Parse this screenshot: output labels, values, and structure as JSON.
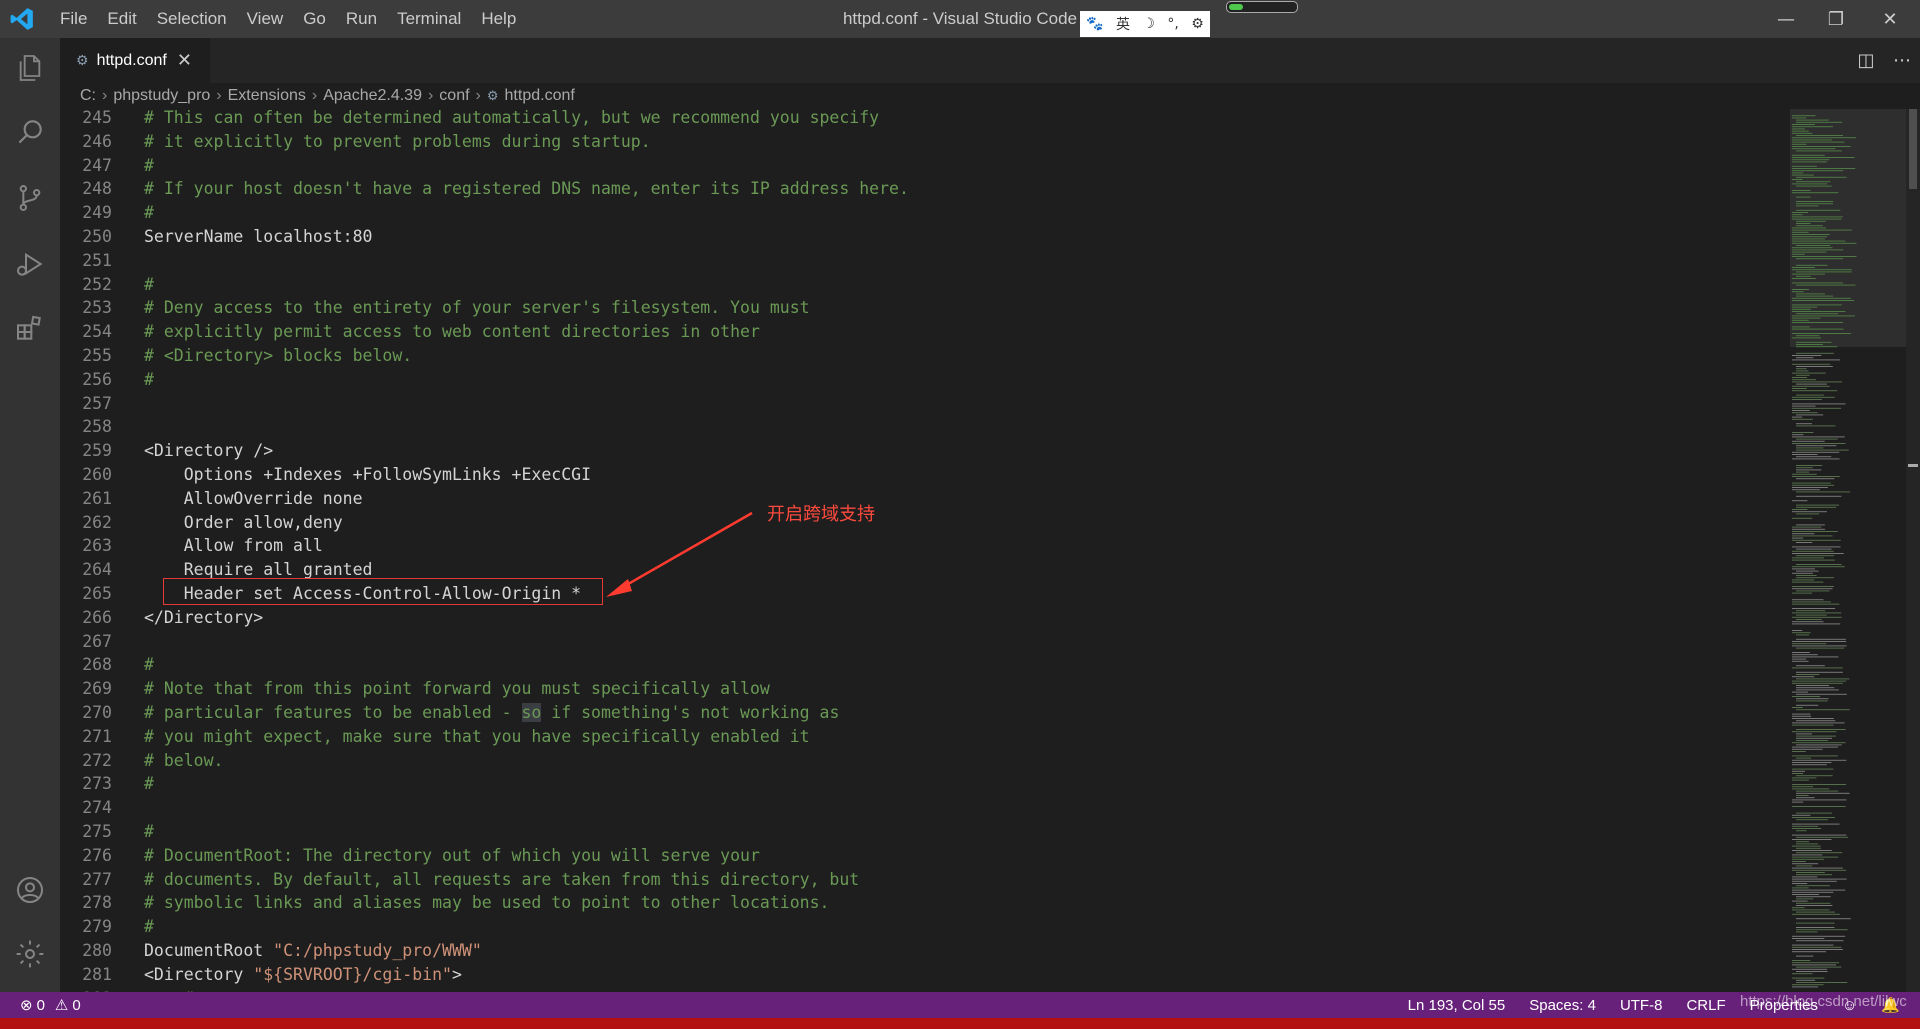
{
  "window": {
    "title": "httpd.conf - Visual Studio Code"
  },
  "menu": [
    "File",
    "Edit",
    "Selection",
    "View",
    "Go",
    "Run",
    "Terminal",
    "Help"
  ],
  "ime": {
    "lang": "英"
  },
  "tab": {
    "label": "httpd.conf",
    "close": "✕"
  },
  "breadcrumb": [
    "C:",
    "phpstudy_pro",
    "Extensions",
    "Apache2.4.39",
    "conf",
    "httpd.conf"
  ],
  "annotation": "开启跨域支持",
  "lines": [
    {
      "n": "245",
      "parts": [
        {
          "t": "# This can often be determined automatically, but we recommend you specify",
          "c": "cm"
        }
      ]
    },
    {
      "n": "246",
      "parts": [
        {
          "t": "# it explicitly to prevent problems during startup.",
          "c": "cm"
        }
      ]
    },
    {
      "n": "247",
      "parts": [
        {
          "t": "#",
          "c": "cm"
        }
      ]
    },
    {
      "n": "248",
      "parts": [
        {
          "t": "# If your host doesn't have a registered DNS name, enter its IP address here.",
          "c": "cm"
        }
      ]
    },
    {
      "n": "249",
      "parts": [
        {
          "t": "#",
          "c": "cm"
        }
      ]
    },
    {
      "n": "250",
      "parts": [
        {
          "t": "ServerName localhost:80",
          "c": "tx"
        }
      ]
    },
    {
      "n": "251",
      "parts": []
    },
    {
      "n": "252",
      "parts": [
        {
          "t": "#",
          "c": "cm"
        }
      ]
    },
    {
      "n": "253",
      "parts": [
        {
          "t": "# Deny access to the entirety of your server's filesystem. You must",
          "c": "cm"
        }
      ]
    },
    {
      "n": "254",
      "parts": [
        {
          "t": "# explicitly permit access to web content directories in other",
          "c": "cm"
        }
      ]
    },
    {
      "n": "255",
      "parts": [
        {
          "t": "# <Directory> blocks below.",
          "c": "cm"
        }
      ]
    },
    {
      "n": "256",
      "parts": [
        {
          "t": "#",
          "c": "cm"
        }
      ]
    },
    {
      "n": "257",
      "parts": []
    },
    {
      "n": "258",
      "parts": []
    },
    {
      "n": "259",
      "parts": [
        {
          "t": "<Directory />",
          "c": "tx"
        }
      ]
    },
    {
      "n": "260",
      "parts": [
        {
          "t": "    Options +Indexes +FollowSymLinks +ExecCGI",
          "c": "tx"
        }
      ]
    },
    {
      "n": "261",
      "parts": [
        {
          "t": "    AllowOverride none",
          "c": "tx"
        }
      ]
    },
    {
      "n": "262",
      "parts": [
        {
          "t": "    Order allow,deny",
          "c": "tx"
        }
      ]
    },
    {
      "n": "263",
      "parts": [
        {
          "t": "    Allow from all",
          "c": "tx"
        }
      ]
    },
    {
      "n": "264",
      "parts": [
        {
          "t": "    Require all granted",
          "c": "tx"
        }
      ]
    },
    {
      "n": "265",
      "parts": [
        {
          "t": "    Header set Access-Control-Allow-Origin *",
          "c": "tx"
        }
      ]
    },
    {
      "n": "266",
      "parts": [
        {
          "t": "</Directory>",
          "c": "tx"
        }
      ]
    },
    {
      "n": "267",
      "parts": []
    },
    {
      "n": "268",
      "parts": [
        {
          "t": "#",
          "c": "cm"
        }
      ]
    },
    {
      "n": "269",
      "parts": [
        {
          "t": "# Note that from this point forward you must specifically allow",
          "c": "cm"
        }
      ]
    },
    {
      "n": "270",
      "parts": [
        {
          "t": "# particular features to be enabled - ",
          "c": "cm"
        },
        {
          "t": "so",
          "c": "cm hl"
        },
        {
          "t": " if something's not working as",
          "c": "cm"
        }
      ]
    },
    {
      "n": "271",
      "parts": [
        {
          "t": "# you might expect, make sure that you have specifically enabled it",
          "c": "cm"
        }
      ]
    },
    {
      "n": "272",
      "parts": [
        {
          "t": "# below.",
          "c": "cm"
        }
      ]
    },
    {
      "n": "273",
      "parts": [
        {
          "t": "#",
          "c": "cm"
        }
      ]
    },
    {
      "n": "274",
      "parts": []
    },
    {
      "n": "275",
      "parts": [
        {
          "t": "#",
          "c": "cm"
        }
      ]
    },
    {
      "n": "276",
      "parts": [
        {
          "t": "# DocumentRoot: The directory out of which you will serve your",
          "c": "cm"
        }
      ]
    },
    {
      "n": "277",
      "parts": [
        {
          "t": "# documents. By default, all requests are taken from this directory, but",
          "c": "cm"
        }
      ]
    },
    {
      "n": "278",
      "parts": [
        {
          "t": "# symbolic links and aliases may be used to point to other locations.",
          "c": "cm"
        }
      ]
    },
    {
      "n": "279",
      "parts": [
        {
          "t": "#",
          "c": "cm"
        }
      ]
    },
    {
      "n": "280",
      "parts": [
        {
          "t": "DocumentRoot ",
          "c": "tx"
        },
        {
          "t": "\"C:/phpstudy_pro/WWW\"",
          "c": "st"
        }
      ]
    },
    {
      "n": "281",
      "parts": [
        {
          "t": "<Directory ",
          "c": "tx"
        },
        {
          "t": "\"${SRVROOT}/cgi-bin\"",
          "c": "st"
        },
        {
          "t": ">",
          "c": "tx"
        }
      ]
    },
    {
      "n": "282",
      "parts": [
        {
          "t": "    #",
          "c": "cm"
        }
      ]
    }
  ],
  "status": {
    "errors": "0",
    "warnings": "0",
    "position": "Ln 193, Col 55",
    "spaces": "Spaces: 4",
    "encoding": "UTF-8",
    "eol": "CRLF",
    "language": "Properties"
  },
  "watermark": "https://blog.csdn.net/lilwc",
  "colors": {
    "statusbar": "#68217a",
    "comment": "#6a9955",
    "string": "#ce9178",
    "annotation": "#ff4a3d"
  }
}
